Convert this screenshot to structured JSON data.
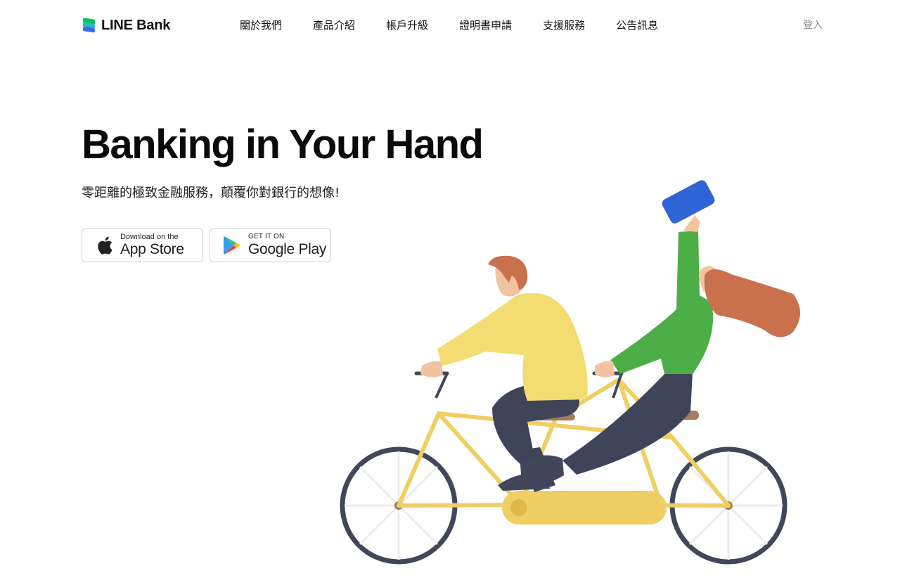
{
  "header": {
    "logo_text": "LINE Bank",
    "nav": [
      {
        "label": "關於我們"
      },
      {
        "label": "產品介紹"
      },
      {
        "label": "帳戶升級"
      },
      {
        "label": "證明書申請"
      },
      {
        "label": "支援服務"
      },
      {
        "label": "公告訊息"
      }
    ],
    "login_label": "登入"
  },
  "hero": {
    "title": "Banking in Your Hand",
    "subtitle": "零距離的極致金融服務，顛覆你對銀行的想像!",
    "app_store": {
      "small": "Download on the",
      "big": "App Store",
      "icon": "apple-icon"
    },
    "google_play": {
      "small": "GET IT ON",
      "big": "Google Play",
      "icon": "google-play-icon"
    }
  },
  "colors": {
    "brand_green": "#06c755",
    "brand_blue": "#3a6ee8",
    "bike_yellow": "#efcf64",
    "man_shirt": "#f3dc72",
    "woman_shirt": "#4cae47",
    "hair": "#c9714d",
    "pants": "#3f4459",
    "phone_blue": "#2f64d6"
  }
}
